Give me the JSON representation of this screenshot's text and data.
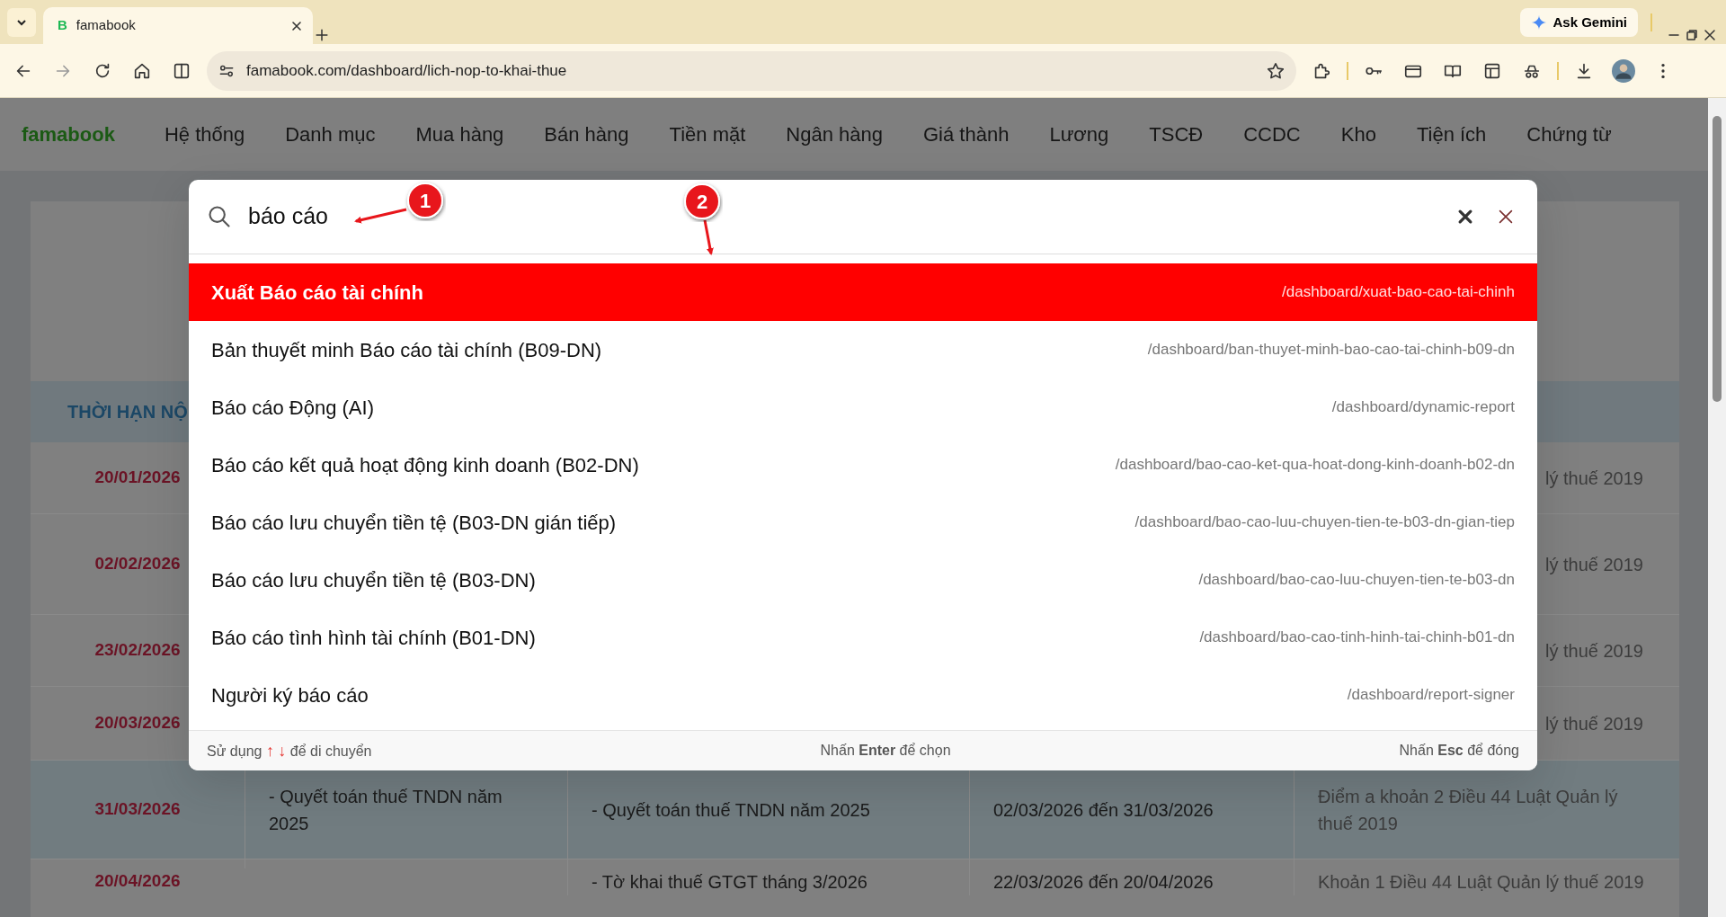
{
  "browser": {
    "tab": {
      "favicon": "B",
      "title": "famabook"
    },
    "ask_gemini": "Ask Gemini",
    "address": "famabook.com/dashboard/lich-nop-to-khai-thue"
  },
  "navbar": {
    "brand": "famabook",
    "items": [
      "Hệ thống",
      "Danh mục",
      "Mua hàng",
      "Bán hàng",
      "Tiền mặt",
      "Ngân hàng",
      "Giá thành",
      "Lương",
      "TSCĐ",
      "CCDC",
      "Kho",
      "Tiện ích",
      "Chứng từ"
    ]
  },
  "background_table": {
    "header": "THỜI HẠN NỘ",
    "rows": [
      {
        "date": "20/01/2026",
        "highlighted": false,
        "column_5": "lý thuế 2019"
      },
      {
        "date": "02/02/2026",
        "highlighted": false,
        "column_5": "lý thuế 2019"
      },
      {
        "date": "23/02/2026",
        "highlighted": false,
        "column_5": "lý thuế 2019"
      },
      {
        "date": "20/03/2026",
        "highlighted": false,
        "column_5": "lý thuế 2019"
      },
      {
        "date": "31/03/2026",
        "highlighted": true,
        "column_2": "- Quyết toán thuế TNDN năm 2025",
        "column_3": "- Quyết toán thuế TNDN năm 2025",
        "column_4": "02/03/2026 đến 31/03/2026",
        "column_5": "Điểm a khoản 2 Điều 44 Luật Quản lý thuế 2019"
      },
      {
        "date": "20/04/2026",
        "highlighted": false,
        "column_3": "- Tờ khai thuế GTGT tháng 3/2026",
        "column_4": "22/03/2026 đến 20/04/2026",
        "column_5": "Khoản 1 Điều 44 Luật Quản lý thuế 2019"
      }
    ]
  },
  "search_dialog": {
    "query": "báo cáo",
    "results": [
      {
        "title": "Xuất Báo cáo tài chính",
        "path": "/dashboard/xuat-bao-cao-tai-chinh",
        "selected": true
      },
      {
        "title": "Bản thuyết minh Báo cáo tài chính (B09-DN)",
        "path": "/dashboard/ban-thuyet-minh-bao-cao-tai-chinh-b09-dn",
        "selected": false
      },
      {
        "title": "Báo cáo Động (AI)",
        "path": "/dashboard/dynamic-report",
        "selected": false
      },
      {
        "title": "Báo cáo kết quả hoạt động kinh doanh (B02-DN)",
        "path": "/dashboard/bao-cao-ket-qua-hoat-dong-kinh-doanh-b02-dn",
        "selected": false
      },
      {
        "title": "Báo cáo lưu chuyển tiền tệ (B03-DN gián tiếp)",
        "path": "/dashboard/bao-cao-luu-chuyen-tien-te-b03-dn-gian-tiep",
        "selected": false
      },
      {
        "title": "Báo cáo lưu chuyển tiền tệ (B03-DN)",
        "path": "/dashboard/bao-cao-luu-chuyen-tien-te-b03-dn",
        "selected": false
      },
      {
        "title": "Báo cáo tình hình tài chính (B01-DN)",
        "path": "/dashboard/bao-cao-tinh-hinh-tai-chinh-b01-dn",
        "selected": false
      },
      {
        "title": "Người ký báo cáo",
        "path": "/dashboard/report-signer",
        "selected": false
      }
    ],
    "footer": {
      "move_hint": {
        "prefix": "Sử dụng",
        "keys": [
          "↑",
          "↓"
        ],
        "suffix": "để di chuyển"
      },
      "select_hint": "Nhấn **Enter** để chọn",
      "close_hint": "Nhấn **Esc** để đóng"
    }
  },
  "annotations": [
    {
      "label": "1"
    },
    {
      "label": "2"
    }
  ]
}
